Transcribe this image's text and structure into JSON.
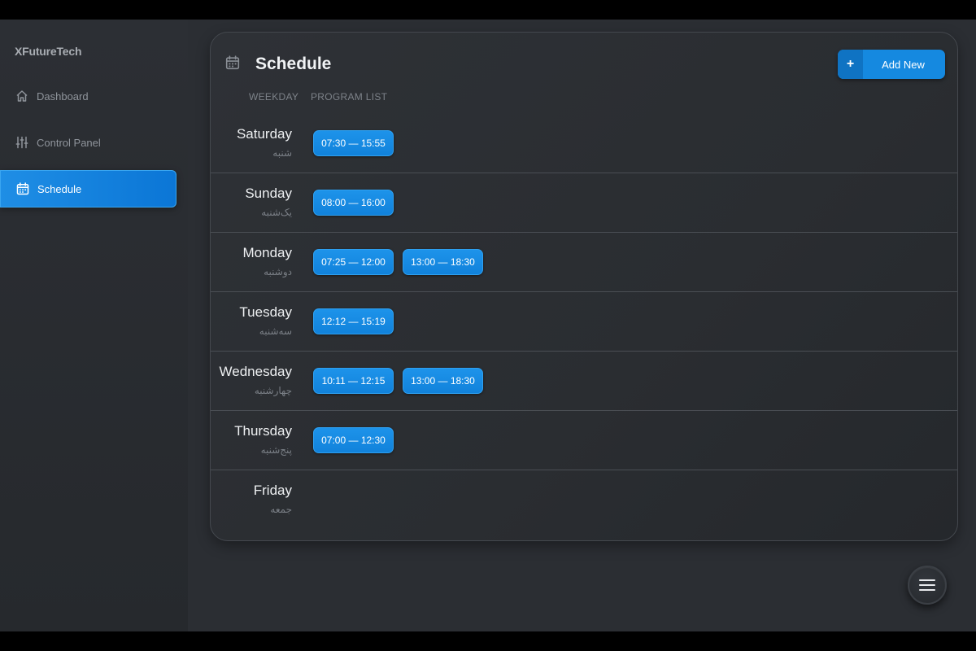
{
  "brand": "XFutureTech",
  "sidebar": {
    "items": [
      {
        "label": "Dashboard",
        "icon": "home-icon",
        "active": false
      },
      {
        "label": "Control Panel",
        "icon": "sliders-icon",
        "active": false
      },
      {
        "label": "Schedule",
        "icon": "calendar-icon",
        "active": true
      }
    ]
  },
  "schedule": {
    "title": "Schedule",
    "add_button": {
      "plus": "+",
      "label": "Add New"
    },
    "columns": {
      "weekday": "WEEKDAY",
      "program": "PROGRAM LIST"
    },
    "days": [
      {
        "name": "Saturday",
        "name_fa": "شنبه",
        "programs": [
          "07:30 — 15:55"
        ]
      },
      {
        "name": "Sunday",
        "name_fa": "یک‌شنبه",
        "programs": [
          "08:00 — 16:00"
        ]
      },
      {
        "name": "Monday",
        "name_fa": "دوشنبه",
        "programs": [
          "07:25 — 12:00",
          "13:00 — 18:30"
        ]
      },
      {
        "name": "Tuesday",
        "name_fa": "سه‌شنبه",
        "programs": [
          "12:12 — 15:19"
        ]
      },
      {
        "name": "Wednesday",
        "name_fa": "چهارشنبه",
        "programs": [
          "10:11 — 12:15",
          "13:00 — 18:30"
        ]
      },
      {
        "name": "Thursday",
        "name_fa": "پنج‌شنبه",
        "programs": [
          "07:00 — 12:30"
        ]
      },
      {
        "name": "Friday",
        "name_fa": "جمعه",
        "programs": []
      }
    ]
  },
  "fab": {
    "icon": "menu-icon"
  },
  "colors": {
    "accent": "#1589e0",
    "background": "#2b2e33"
  }
}
